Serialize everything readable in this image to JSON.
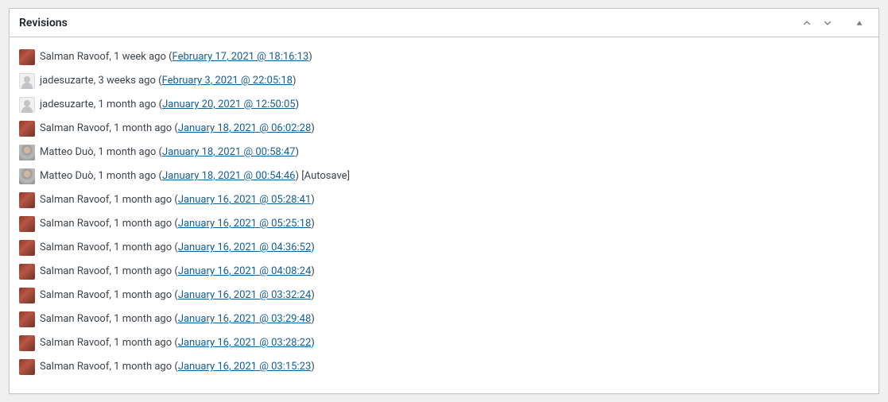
{
  "panel": {
    "title": "Revisions"
  },
  "revisions": [
    {
      "avatar": "salman",
      "author": "Salman Ravoof",
      "ago": "1 week ago",
      "link": "February 17, 2021 @ 18:16:13",
      "suffix": ""
    },
    {
      "avatar": "jade",
      "author": "jadesuzarte",
      "ago": "3 weeks ago",
      "link": "February 3, 2021 @ 22:05:18",
      "suffix": ""
    },
    {
      "avatar": "jade",
      "author": "jadesuzarte",
      "ago": "1 month ago",
      "link": "January 20, 2021 @ 12:50:05",
      "suffix": ""
    },
    {
      "avatar": "salman",
      "author": "Salman Ravoof",
      "ago": "1 month ago",
      "link": "January 18, 2021 @ 06:02:28",
      "suffix": ""
    },
    {
      "avatar": "matteo",
      "author": "Matteo Duò",
      "ago": "1 month ago",
      "link": "January 18, 2021 @ 00:58:47",
      "suffix": ""
    },
    {
      "avatar": "matteo",
      "author": "Matteo Duò",
      "ago": "1 month ago",
      "link": "January 18, 2021 @ 00:54:46",
      "suffix": " [Autosave]"
    },
    {
      "avatar": "salman",
      "author": "Salman Ravoof",
      "ago": "1 month ago",
      "link": "January 16, 2021 @ 05:28:41",
      "suffix": ""
    },
    {
      "avatar": "salman",
      "author": "Salman Ravoof",
      "ago": "1 month ago",
      "link": "January 16, 2021 @ 05:25:18",
      "suffix": ""
    },
    {
      "avatar": "salman",
      "author": "Salman Ravoof",
      "ago": "1 month ago",
      "link": "January 16, 2021 @ 04:36:52",
      "suffix": ""
    },
    {
      "avatar": "salman",
      "author": "Salman Ravoof",
      "ago": "1 month ago",
      "link": "January 16, 2021 @ 04:08:24",
      "suffix": ""
    },
    {
      "avatar": "salman",
      "author": "Salman Ravoof",
      "ago": "1 month ago",
      "link": "January 16, 2021 @ 03:32:24",
      "suffix": ""
    },
    {
      "avatar": "salman",
      "author": "Salman Ravoof",
      "ago": "1 month ago",
      "link": "January 16, 2021 @ 03:29:48",
      "suffix": ""
    },
    {
      "avatar": "salman",
      "author": "Salman Ravoof",
      "ago": "1 month ago",
      "link": "January 16, 2021 @ 03:28:22",
      "suffix": ""
    },
    {
      "avatar": "salman",
      "author": "Salman Ravoof",
      "ago": "1 month ago",
      "link": "January 16, 2021 @ 03:15:23",
      "suffix": ""
    }
  ]
}
